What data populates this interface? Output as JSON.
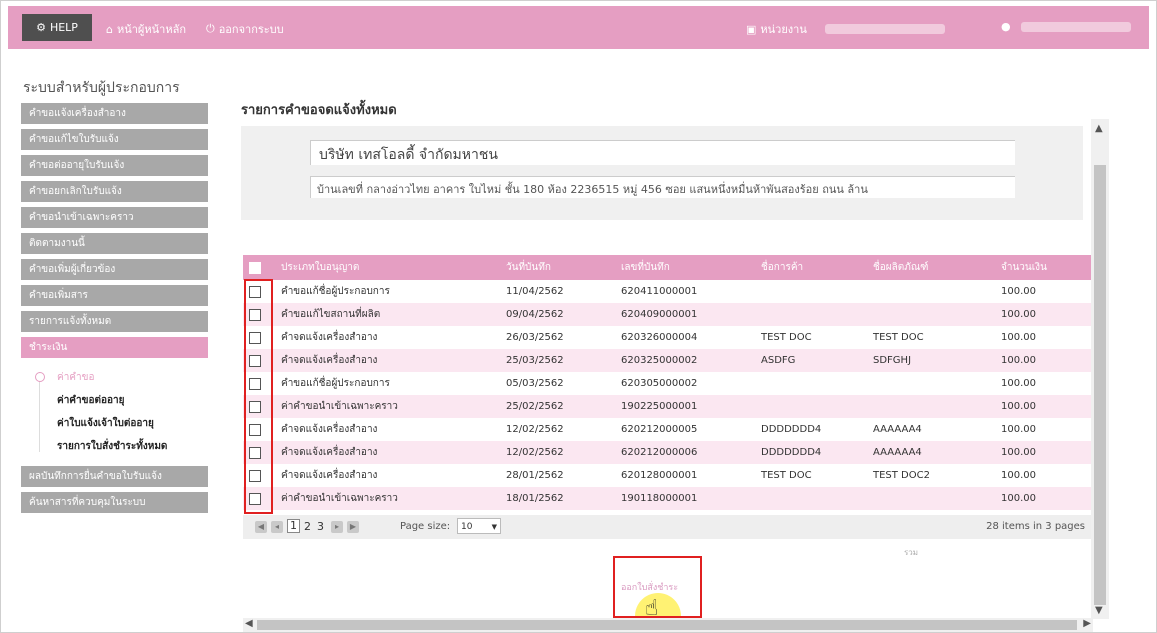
{
  "topbar": {
    "help_label": "HELP",
    "home_label": "หน้าผู้หน้าหลัก",
    "logout_label": "ออกจากระบบ",
    "agency_label": "หน่วยงาน"
  },
  "sidebar": {
    "title": "ระบบสำหรับผู้ประกอบการ",
    "items": [
      {
        "label": "คำขอแจ้งเครื่องสำอาง"
      },
      {
        "label": "คำขอแก้ไขใบรับแจ้ง"
      },
      {
        "label": "คำขอต่ออายุใบรับแจ้ง"
      },
      {
        "label": "คำขอยกเลิกใบรับแจ้ง"
      },
      {
        "label": "คำขอนำเข้าเฉพาะคราว"
      },
      {
        "label": "ติดตามงานนี้"
      },
      {
        "label": "คำขอเพิ่มผู้เกี่ยวข้อง"
      },
      {
        "label": "คำขอเพิ่มสาร"
      },
      {
        "label": "รายการแจ้งทั้งหมด"
      },
      {
        "label": "ชำระเงิน",
        "active": true
      }
    ],
    "submenu": [
      {
        "label": "ค่าคำขอ"
      },
      {
        "label": "ค่าคำขอต่ออายุ"
      },
      {
        "label": "ค่าใบแจ้งเจ้าใบต่ออายุ"
      },
      {
        "label": "รายการใบสั่งชำระทั้งหมด"
      }
    ],
    "bottom_items": [
      {
        "label": "ผลบันทึกการยื่นคำขอใบรับแจ้ง"
      },
      {
        "label": "ค้นหาสารที่ควบคุมในระบบ"
      }
    ]
  },
  "main": {
    "title": "รายการคำขอจดแจ้งทั้งหมด",
    "company_name": "บริษัท เทสโอลดี้ จำกัดมหาชน",
    "company_address": "บ้านเลขที่ กลางอ่าวไทย อาคาร ใบไหม่ ชั้น 180 ห้อง 2236515 หมู่ 456 ซอย แสนหนึ่งหมื่นห้าพันสองร้อย ถนน ล้าน"
  },
  "table": {
    "headers": [
      "ประเภทใบอนุญาต",
      "วันที่บันทึก",
      "เลขที่บันทึก",
      "ชื่อการค้า",
      "ชื่อผลิตภัณฑ์",
      "จำนวนเงิน"
    ],
    "rows": [
      [
        "คำขอแก้ชื่อผู้ประกอบการ",
        "11/04/2562",
        "620411000001",
        "",
        "",
        "100.00"
      ],
      [
        "คำขอแก้ไขสถานที่ผลิต",
        "09/04/2562",
        "620409000001",
        "",
        "",
        "100.00"
      ],
      [
        "คำจดแจ้งเครื่องสำอาง",
        "26/03/2562",
        "620326000004",
        "TEST DOC",
        "TEST DOC",
        "100.00"
      ],
      [
        "คำจดแจ้งเครื่องสำอาง",
        "25/03/2562",
        "620325000002",
        "ASDFG",
        "SDFGHJ",
        "100.00"
      ],
      [
        "คำขอแก้ชื่อผู้ประกอบการ",
        "05/03/2562",
        "620305000002",
        "",
        "",
        "100.00"
      ],
      [
        "ค่าคำขอนำเข้าเฉพาะคราว",
        "25/02/2562",
        "190225000001",
        "",
        "",
        "100.00"
      ],
      [
        "คำจดแจ้งเครื่องสำอาง",
        "12/02/2562",
        "620212000005",
        "DDDDDDD4",
        "AAAAAA4",
        "100.00"
      ],
      [
        "คำจดแจ้งเครื่องสำอาง",
        "12/02/2562",
        "620212000006",
        "DDDDDDD4",
        "AAAAAA4",
        "100.00"
      ],
      [
        "คำจดแจ้งเครื่องสำอาง",
        "28/01/2562",
        "620128000001",
        "TEST DOC",
        "TEST DOC2",
        "100.00"
      ],
      [
        "ค่าคำขอนำเข้าเฉพาะคราว",
        "18/01/2562",
        "190118000001",
        "",
        "",
        "100.00"
      ]
    ]
  },
  "pager": {
    "pages": [
      "1",
      "2",
      "3"
    ],
    "current": "1",
    "page_size_label": "Page size:",
    "page_size_value": "10",
    "info": "28 items in 3 pages"
  },
  "summary": {
    "total_label": "รวม"
  },
  "actions": {
    "print_label": "ออกใบสั่งชำระ"
  },
  "colors": {
    "accent": "#e59ec2",
    "menu_gray": "#a8a8a8",
    "highlight_red": "#e02020"
  }
}
